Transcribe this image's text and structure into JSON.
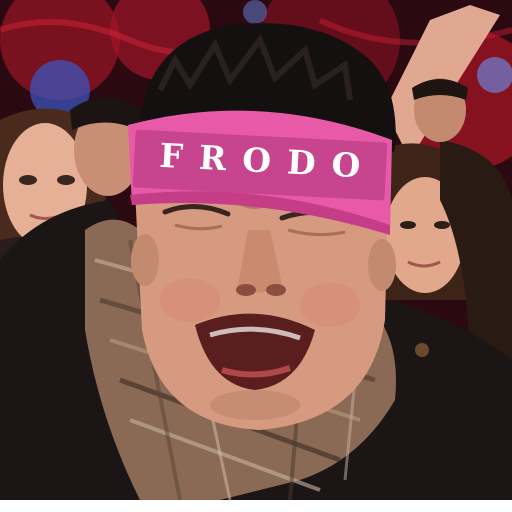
{
  "photo": {
    "subject": "crying-young-man-with-headband",
    "headband_text": "FRODO",
    "headband_letters": [
      "F",
      "R",
      "O",
      "D",
      "O"
    ],
    "colors": {
      "headband": "#e85aa8",
      "headband_shadow": "#c43d86",
      "background_red": "#9e1424",
      "skin": "#d59a80",
      "jacket": "#1b1516",
      "scarf_base": "#8a6a55"
    }
  }
}
